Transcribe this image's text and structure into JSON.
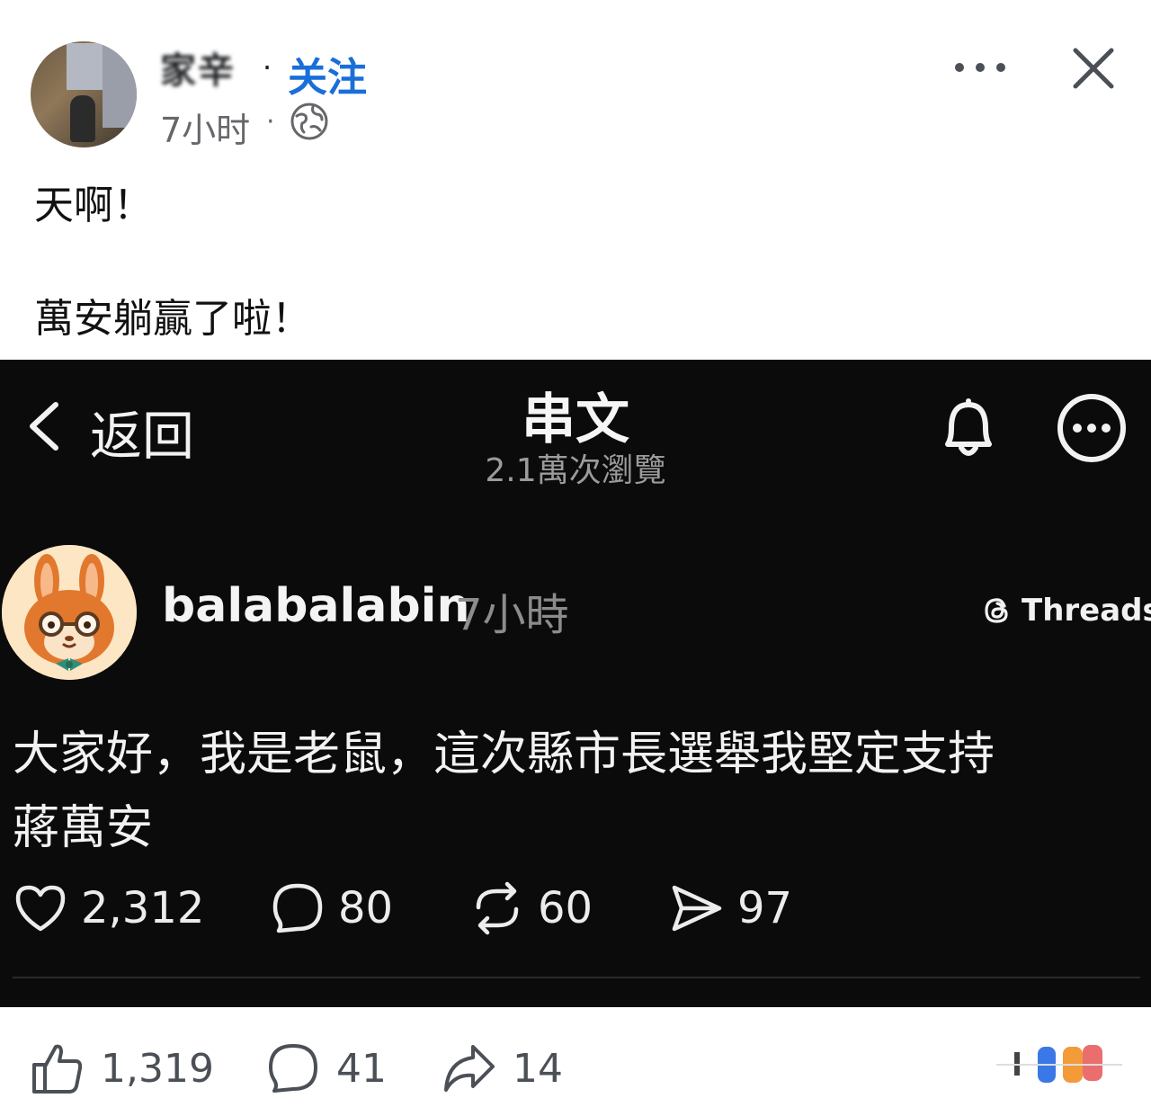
{
  "post": {
    "author_name": "家辛",
    "separator": "·",
    "follow_label": "关注",
    "time": "7小时",
    "meta_separator": "·",
    "privacy_icon": "globe-icon",
    "text_line_1": "天啊！",
    "text_line_2": "萬安躺贏了啦！"
  },
  "threads_embed": {
    "back_label": "返回",
    "title": "串文",
    "views": "2.1萬次瀏覽",
    "username": "balabalabin",
    "time": "7小時",
    "brand": "Threads",
    "body_line_1": "大家好，我是老鼠，這次縣市長選舉我堅定支持",
    "body_line_2": "蔣萬安",
    "stats": {
      "likes": "2,312",
      "replies": "80",
      "reposts": "60",
      "shares": "97"
    }
  },
  "footer": {
    "likes": "1,319",
    "comments": "41",
    "shares": "14"
  },
  "colors": {
    "follow_blue": "#1a6ed8",
    "threads_bg": "#0b0b0b",
    "muted_gray": "#65676b"
  }
}
